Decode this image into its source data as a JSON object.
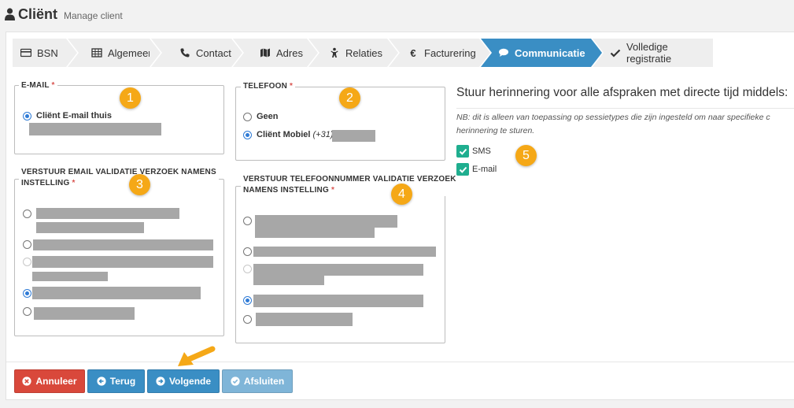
{
  "header": {
    "title": "Cliënt",
    "subtitle": "Manage client"
  },
  "wizard": {
    "steps": [
      {
        "label": "BSN",
        "icon": "id-card-icon"
      },
      {
        "label": "Algemeen",
        "icon": "table-icon"
      },
      {
        "label": "Contact",
        "icon": "phone-icon"
      },
      {
        "label": "Adres",
        "icon": "map-icon"
      },
      {
        "label": "Relaties",
        "icon": "child-icon"
      },
      {
        "label": "Facturering",
        "icon": "euro-icon"
      },
      {
        "label": "Communicatie",
        "icon": "comments-icon",
        "active": true
      },
      {
        "label": "Volledige registratie",
        "icon": "check-icon"
      }
    ]
  },
  "email": {
    "legend": "E-MAIL",
    "required_mark": "*",
    "options": [
      {
        "label": "Cliënt E-mail thuis",
        "checked": true
      }
    ]
  },
  "telefoon": {
    "legend": "TELEFOON",
    "required_mark": "*",
    "options": [
      {
        "label": "Geen",
        "checked": false
      },
      {
        "label": "Cliënt Mobiel",
        "prefix": "(+31)",
        "checked": true
      }
    ]
  },
  "email_validation": {
    "legend_line1": "VERSTUUR EMAIL VALIDATIE VERZOEK NAMENS",
    "legend_line2": "INSTELLING",
    "required_mark": "*"
  },
  "phone_validation": {
    "legend_line1": "VERSTUUR TELEFOONNUMMER VALIDATIE VERZOEK",
    "legend_line2": "NAMENS INSTELLING",
    "required_mark": "*"
  },
  "reminder": {
    "title": "Stuur herinnering voor alle afspraken met directe tijd middels:",
    "note_line1": "NB: dit is alleen van toepassing op sessietypes die zijn ingesteld om naar specifieke c",
    "note_line2": "herinnering te sturen.",
    "options": [
      {
        "label": "SMS",
        "checked": true
      },
      {
        "label": "E-mail",
        "checked": true
      }
    ]
  },
  "badges": [
    "1",
    "2",
    "3",
    "4",
    "5"
  ],
  "buttons": {
    "cancel": "Annuleer",
    "back": "Terug",
    "next": "Volgende",
    "finish": "Afsluiten"
  },
  "colors": {
    "primary": "#3a8ec4",
    "danger": "#d9483b",
    "checkbox": "#1fae8f",
    "badge": "#f5a817",
    "disabled_button": "#7fb5d8"
  }
}
